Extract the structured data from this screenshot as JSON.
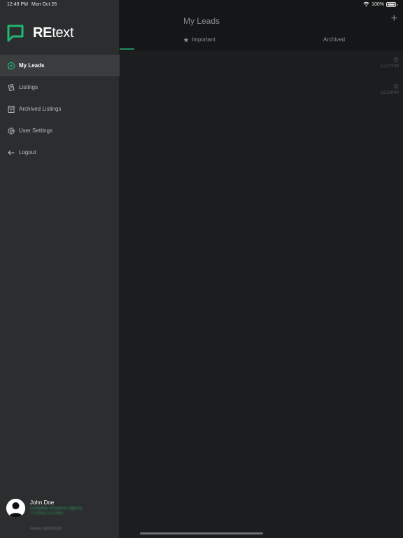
{
  "status": {
    "time": "12:49 PM",
    "date": "Mon Oct 26",
    "battery": "100%"
  },
  "app": {
    "logo_bold": "RE",
    "logo_light": "text"
  },
  "sidebar": {
    "items": [
      {
        "label": "My Leads",
        "icon": "chat-bubble-icon",
        "active": true
      },
      {
        "label": "Listings",
        "icon": "document-icon",
        "active": false
      },
      {
        "label": "Archived Listings",
        "icon": "archive-document-icon",
        "active": false
      },
      {
        "label": "User Settings",
        "icon": "gear-icon",
        "active": false
      },
      {
        "label": "Logout",
        "icon": "arrow-left-icon",
        "active": false
      }
    ],
    "profile": {
      "name": "John Doe",
      "line1": "Company Insurance agency",
      "line2": "+1 (555) 123-4567"
    },
    "version": "Version 3@26/10/20"
  },
  "main": {
    "title": "My Leads",
    "add_label": "+",
    "tabs": [
      {
        "label": "Important",
        "icon": "star-icon"
      },
      {
        "label": "Archived"
      }
    ],
    "leads": [
      {
        "time": "12:27PM"
      },
      {
        "time": "12:28PM"
      }
    ]
  },
  "colors": {
    "accent": "#1f8f5f",
    "sidebar_bg": "#2b2d2e",
    "main_bg": "#1c1d1e",
    "header_bg": "#151617"
  }
}
